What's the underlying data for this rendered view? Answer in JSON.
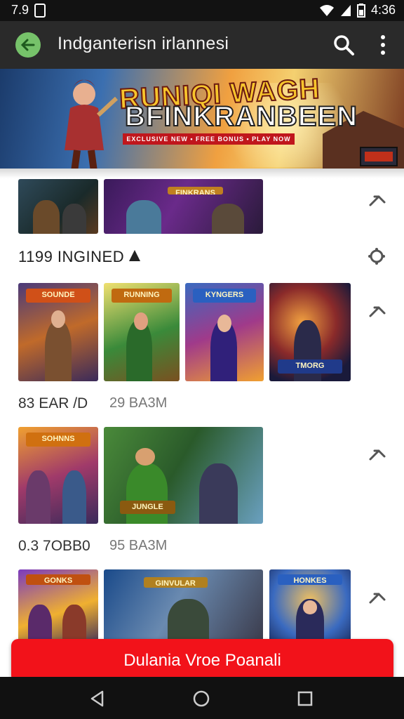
{
  "status_bar": {
    "time_left": "7.9",
    "time_right": "4:36"
  },
  "app_bar": {
    "title": "Indganterisn irlannesi"
  },
  "banner": {
    "title_line1": "RUNIQI WAGH",
    "title_line2": "BFINKRANBEEN",
    "ribbon": "EXCLUSIVE NEW • FREE BONUS • PLAY NOW"
  },
  "sections": [
    {
      "title": "1199 INGINED",
      "meta_left": "",
      "meta_right": ""
    },
    {
      "title": "",
      "meta_left": "83 EAR /D",
      "meta_right": "29 BA3M"
    },
    {
      "title": "",
      "meta_left": "0.3 7OBB0",
      "meta_right": "95 BA3M"
    }
  ],
  "thumb_logos": {
    "t1": "",
    "t2": "FINKRANS",
    "t3": "SOUNDE",
    "t4": "RUNNING",
    "t5": "KYNGERS",
    "t6": "TMORG",
    "t7": "SOHNNS",
    "t8": "JUNGLE",
    "t9": "GONKS",
    "t10": "GINVULAR",
    "t11": "HONKES"
  },
  "cta": {
    "label": "Dulania Vroe Poanali"
  },
  "colors": {
    "cta": "#f2121a",
    "app_bar": "#2a2a2a",
    "back_button": "#76c26a"
  },
  "icons": [
    "wifi-icon",
    "signal-icon",
    "battery-icon",
    "back-arrow-icon",
    "search-icon",
    "more-vert-icon",
    "share-arrow-icon",
    "settings-icon",
    "nav-back-icon",
    "nav-home-icon",
    "nav-recents-icon"
  ]
}
